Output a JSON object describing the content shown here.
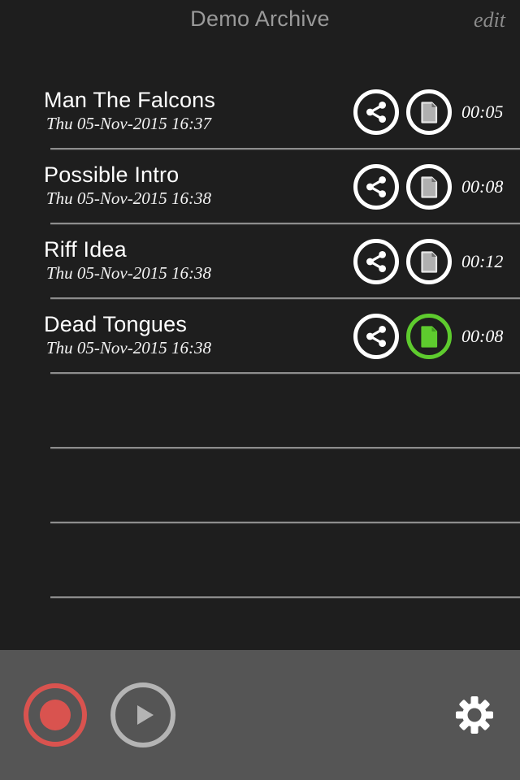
{
  "header": {
    "title": "Demo Archive",
    "edit_label": "edit"
  },
  "colors": {
    "background": "#1e1e1e",
    "toolbar_background": "#555555",
    "accent_green": "#5ecb2e",
    "record_red": "#d9534f",
    "separator": "#8d8d8d",
    "title_text": "#9a9a9a",
    "item_title_text": "#ffffff"
  },
  "list": {
    "items": [
      {
        "title": "Man The Falcons",
        "date": "Thu 05-Nov-2015 16:37",
        "duration": "00:05",
        "share_icon": "share-icon",
        "document_icon": "document-icon",
        "document_selected": false
      },
      {
        "title": "Possible Intro",
        "date": "Thu 05-Nov-2015 16:38",
        "duration": "00:08",
        "share_icon": "share-icon",
        "document_icon": "document-icon",
        "document_selected": false
      },
      {
        "title": "Riff Idea",
        "date": "Thu 05-Nov-2015 16:38",
        "duration": "00:12",
        "share_icon": "share-icon",
        "document_icon": "document-icon",
        "document_selected": false
      },
      {
        "title": "Dead Tongues",
        "date": "Thu 05-Nov-2015 16:38",
        "duration": "00:08",
        "share_icon": "share-icon",
        "document_icon": "document-icon",
        "document_selected": true
      }
    ],
    "empty_row_count": 3
  },
  "toolbar": {
    "record_icon": "record-icon",
    "play_icon": "play-icon",
    "settings_icon": "gear-icon"
  }
}
